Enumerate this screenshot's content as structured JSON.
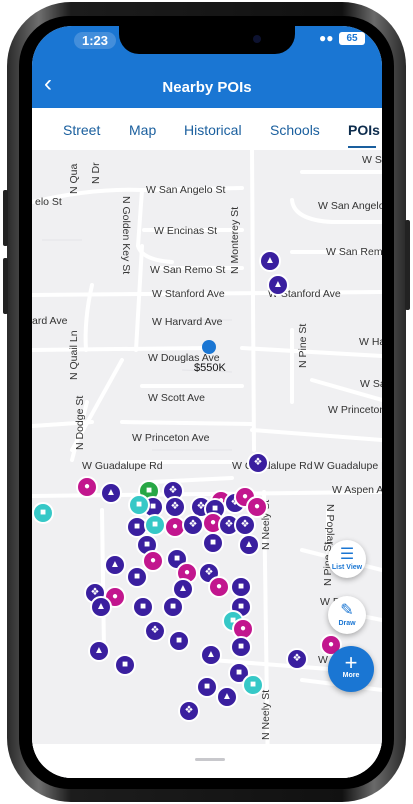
{
  "status": {
    "time": "1:23",
    "battery": "65"
  },
  "header": {
    "title": "Nearby POIs",
    "back_icon": "chevron-left-icon"
  },
  "tabs": [
    {
      "label": "Street",
      "active": false
    },
    {
      "label": "Map",
      "active": false
    },
    {
      "label": "Historical",
      "active": false
    },
    {
      "label": "Schools",
      "active": false
    },
    {
      "label": "POIs",
      "active": true
    }
  ],
  "map": {
    "streets": {
      "s1": "N Qua",
      "s2": "N Dr",
      "s3": "W San Angelo St",
      "s4": "W San Angelo",
      "s5": "N Golden Key St",
      "s6": "W Encinas St",
      "s7": "N Monterey St",
      "s8": "W San Remo St",
      "s9": "W San Remo",
      "s10": "W Stanford Ave",
      "s11": "W Stanford Ave",
      "s12": "ard Ave",
      "s13": "W Harvard Ave",
      "s14": "N Quail Ln",
      "s15": "W Douglas Ave",
      "s16": "N Pine St",
      "s17": "W Ha",
      "s18": "N Dodge St",
      "s19": "W Scott Ave",
      "s20": "W Princeton Ave",
      "s21": "W Princeton Ave",
      "s22": "W Guadalupe Rd",
      "s23": "W Guadalupe Rd",
      "s24": "W Guadalupe R",
      "s25": "W Aspen A",
      "s26": "N Poplar",
      "s27": "N Neely St",
      "s28": "N Pine St",
      "s29": "W Pi",
      "s30": "W Juni",
      "s31": "N Neely St",
      "s32": "elo St",
      "s33": "W S",
      "s34": "W Sa"
    },
    "property_price": "$550K",
    "colors": {
      "poi_purple": "#3a1f9f",
      "poi_magenta": "#c2168e",
      "poi_teal": "#36c8c7",
      "poi_green": "#28a745",
      "location": "#1a76d3",
      "brand": "#1a76d3"
    }
  },
  "actions": {
    "list_view": {
      "label": "List View",
      "icon": "list-icon"
    },
    "draw": {
      "label": "Draw",
      "icon": "pencil-icon"
    },
    "more": {
      "label": "More",
      "icon": "plus-icon"
    }
  }
}
